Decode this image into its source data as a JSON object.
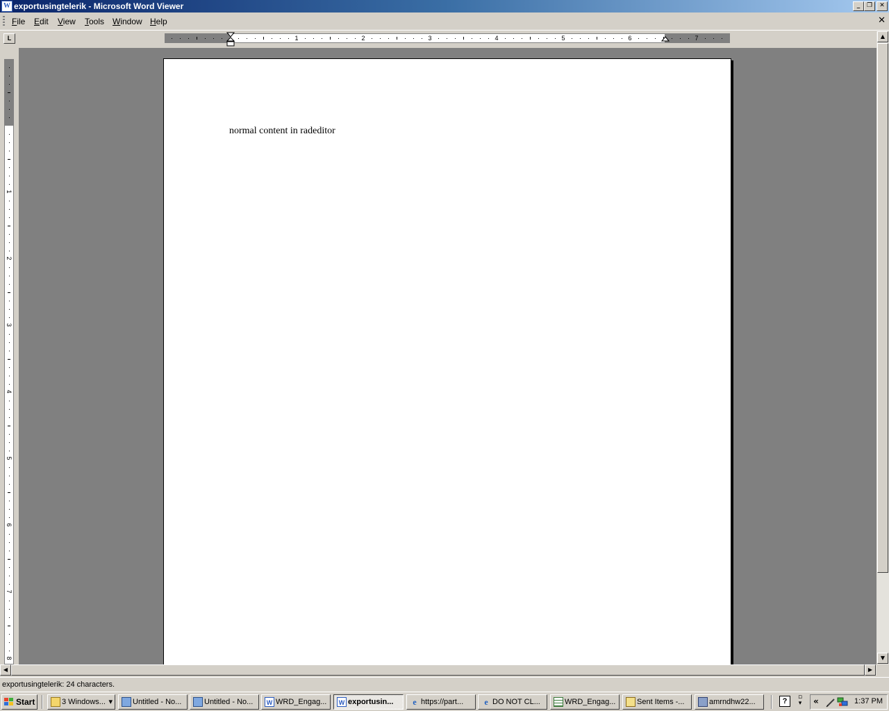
{
  "window": {
    "app_icon_letter": "W",
    "title": "exportusingtelerik - Microsoft Word Viewer",
    "min_glyph": "_",
    "restore_glyph": "❐",
    "close_glyph": "✕"
  },
  "menu": {
    "items": [
      {
        "label": "File",
        "accel": "F",
        "rest": "ile"
      },
      {
        "label": "Edit",
        "accel": "E",
        "rest": "dit"
      },
      {
        "label": "View",
        "accel": "V",
        "rest": "iew"
      },
      {
        "label": "Tools",
        "accel": "T",
        "rest": "ools"
      },
      {
        "label": "Window",
        "accel": "W",
        "rest": "indow"
      },
      {
        "label": "Help",
        "accel": "H",
        "rest": "elp"
      }
    ],
    "doc_close_glyph": "✕"
  },
  "ruler": {
    "tab_selector": "L",
    "horizontal_numbers": [
      "1",
      "2",
      "3",
      "4",
      "5",
      "6",
      "7"
    ],
    "vertical_numbers": [
      "1",
      "2",
      "3",
      "4",
      "5",
      "6",
      "7",
      "8"
    ]
  },
  "document": {
    "body_text": "normal content in radeditor"
  },
  "scrollbars": {
    "up_glyph": "▲",
    "down_glyph": "▼",
    "left_glyph": "◀",
    "right_glyph": "▶"
  },
  "status": {
    "text": "exportusingtelerik: 24 characters."
  },
  "taskbar": {
    "start_label": "Start",
    "buttons": [
      {
        "label": "3 Windows...",
        "icon": "folder-icon"
      },
      {
        "label": "Untitled - No...",
        "icon": "notepad-icon"
      },
      {
        "label": "Untitled - No...",
        "icon": "notepad-icon"
      },
      {
        "label": "WRD_Engag...",
        "icon": "word-icon"
      },
      {
        "label": "exportusin...",
        "icon": "word-icon"
      },
      {
        "label": "https://part...",
        "icon": "ie-icon"
      },
      {
        "label": "DO NOT CL...",
        "icon": "ie-icon"
      },
      {
        "label": "WRD_Engag...",
        "icon": "excel-icon"
      },
      {
        "label": "Sent Items -...",
        "icon": "mail-icon"
      },
      {
        "label": "amrndhw22...",
        "icon": "app-icon"
      }
    ],
    "group_arrow": "▾",
    "help_glyph": "?",
    "tray_chevron": "«",
    "clock": "1:37 PM"
  }
}
